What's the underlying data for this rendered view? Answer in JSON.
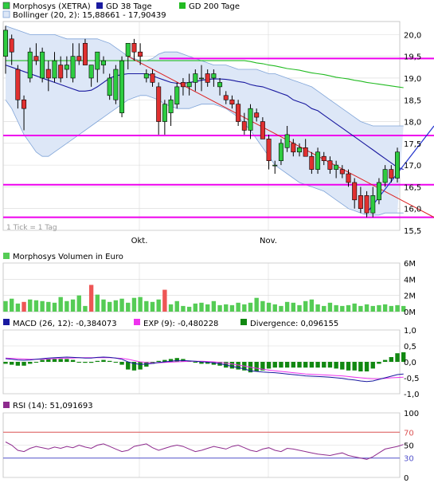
{
  "colors": {
    "up": "#2ecc40",
    "down": "#e03030",
    "gd38": "#1a1aa0",
    "gd200": "#22bb22",
    "band_fill": "#dde7f7",
    "band_line": "#7fa4d8",
    "magenta": "#ee00ee",
    "trend_red": "#dd2222",
    "trend_blue": "#2233cc",
    "volume": "#55cc55",
    "volume_high": "#ee5555",
    "macd": "#1a1aa0",
    "exp": "#ee33ee",
    "divergence": "#118811",
    "rsi": "#8e2b8e",
    "rsi_ref_70": "#dd5555",
    "rsi_ref_30": "#5555cc",
    "grid": "#d8d8d8"
  },
  "legend_main": {
    "series1": "Morphosys (XETRA)",
    "series2": "GD 38 Tage",
    "series3": "GD 200 Tage",
    "bollinger": "Bollinger (20, 2): 15,88661 - 17,90439"
  },
  "tick_note": "1 Tick = 1 Tag",
  "x_labels": [
    "Okt.",
    "Nov."
  ],
  "volume_title": "Morphosys Volumen in Euro",
  "macd_legend": {
    "macd": "MACD (26, 12): -0,384073",
    "exp": "EXP (9): -0,480228",
    "div": "Divergence: 0,096155"
  },
  "rsi_legend": "RSI (14): 51,091693",
  "chart_data": [
    {
      "type": "candlestick",
      "title": "Morphosys (XETRA)",
      "y_ticks": [
        "20,0",
        "19,5",
        "19,0",
        "18,5",
        "18,0",
        "17,5",
        "17,0",
        "16,5",
        "16,0",
        "15,5"
      ],
      "ylim": [
        15.5,
        20.3
      ],
      "x_ticks": [
        "Okt.",
        "Nov."
      ],
      "grid": true,
      "legend_position": "top-left",
      "candles": [
        {
          "o": 19.5,
          "h": 20.2,
          "l": 19.1,
          "c": 20.1
        },
        {
          "o": 19.9,
          "h": 20.0,
          "l": 19.3,
          "c": 19.6
        },
        {
          "o": 19.2,
          "h": 19.3,
          "l": 18.3,
          "c": 18.5
        },
        {
          "o": 18.5,
          "h": 18.6,
          "l": 17.8,
          "c": 18.3
        },
        {
          "o": 19.0,
          "h": 19.7,
          "l": 18.9,
          "c": 19.6
        },
        {
          "o": 19.5,
          "h": 19.8,
          "l": 19.3,
          "c": 19.4
        },
        {
          "o": 19.0,
          "h": 19.7,
          "l": 18.9,
          "c": 19.6
        },
        {
          "o": 19.2,
          "h": 19.4,
          "l": 18.7,
          "c": 19.0
        },
        {
          "o": 19.0,
          "h": 19.6,
          "l": 18.9,
          "c": 19.4
        },
        {
          "o": 19.3,
          "h": 19.5,
          "l": 18.9,
          "c": 19.0
        },
        {
          "o": 19.2,
          "h": 19.5,
          "l": 19.0,
          "c": 19.3
        },
        {
          "o": 19.0,
          "h": 19.8,
          "l": 18.9,
          "c": 19.5
        },
        {
          "o": 19.5,
          "h": 19.8,
          "l": 19.3,
          "c": 19.4
        },
        {
          "o": 19.8,
          "h": 19.9,
          "l": 19.3,
          "c": 19.3
        },
        {
          "o": 19.0,
          "h": 19.3,
          "l": 18.8,
          "c": 19.3
        },
        {
          "o": 19.2,
          "h": 19.6,
          "l": 18.9,
          "c": 19.6
        },
        {
          "o": 19.3,
          "h": 19.5,
          "l": 19.1,
          "c": 19.4
        },
        {
          "o": 18.6,
          "h": 19.1,
          "l": 18.5,
          "c": 19.0
        },
        {
          "o": 18.5,
          "h": 19.3,
          "l": 18.4,
          "c": 19.2
        },
        {
          "o": 18.2,
          "h": 19.5,
          "l": 18.1,
          "c": 19.4
        },
        {
          "o": 19.5,
          "h": 19.8,
          "l": 19.2,
          "c": 19.8
        },
        {
          "o": 19.8,
          "h": 19.9,
          "l": 19.4,
          "c": 19.6
        },
        {
          "o": 19.6,
          "h": 19.8,
          "l": 19.3,
          "c": 19.5
        },
        {
          "o": 19.0,
          "h": 19.2,
          "l": 18.9,
          "c": 19.1
        },
        {
          "o": 19.1,
          "h": 19.2,
          "l": 18.8,
          "c": 18.9
        },
        {
          "o": 18.8,
          "h": 18.9,
          "l": 17.7,
          "c": 18.0
        },
        {
          "o": 18.0,
          "h": 18.5,
          "l": 17.7,
          "c": 18.4
        },
        {
          "o": 18.2,
          "h": 18.6,
          "l": 17.9,
          "c": 18.5
        },
        {
          "o": 18.4,
          "h": 18.9,
          "l": 18.3,
          "c": 18.8
        },
        {
          "o": 18.9,
          "h": 19.0,
          "l": 18.6,
          "c": 18.8
        },
        {
          "o": 18.8,
          "h": 19.1,
          "l": 18.6,
          "c": 18.9
        },
        {
          "o": 18.9,
          "h": 19.2,
          "l": 18.7,
          "c": 19.1
        },
        {
          "o": 19.0,
          "h": 19.3,
          "l": 18.7,
          "c": 19.0
        },
        {
          "o": 19.1,
          "h": 19.2,
          "l": 18.8,
          "c": 18.9
        },
        {
          "o": 19.0,
          "h": 19.2,
          "l": 18.8,
          "c": 19.1
        },
        {
          "o": 18.8,
          "h": 19.0,
          "l": 18.6,
          "c": 18.9
        },
        {
          "o": 18.6,
          "h": 18.7,
          "l": 18.4,
          "c": 18.5
        },
        {
          "o": 18.5,
          "h": 18.6,
          "l": 18.3,
          "c": 18.4
        },
        {
          "o": 18.4,
          "h": 18.5,
          "l": 17.9,
          "c": 18.0
        },
        {
          "o": 18.0,
          "h": 18.2,
          "l": 17.7,
          "c": 17.8
        },
        {
          "o": 17.8,
          "h": 18.4,
          "l": 17.6,
          "c": 18.3
        },
        {
          "o": 18.2,
          "h": 18.3,
          "l": 18.0,
          "c": 18.1
        },
        {
          "o": 18.0,
          "h": 18.1,
          "l": 17.6,
          "c": 17.6
        },
        {
          "o": 17.6,
          "h": 17.7,
          "l": 16.9,
          "c": 17.1
        },
        {
          "o": 17.0,
          "h": 17.1,
          "l": 16.8,
          "c": 17.0
        },
        {
          "o": 17.1,
          "h": 17.6,
          "l": 17.0,
          "c": 17.5
        },
        {
          "o": 17.4,
          "h": 17.9,
          "l": 17.3,
          "c": 17.7
        },
        {
          "o": 17.5,
          "h": 17.6,
          "l": 17.2,
          "c": 17.3
        },
        {
          "o": 17.3,
          "h": 17.5,
          "l": 17.2,
          "c": 17.4
        },
        {
          "o": 17.4,
          "h": 17.6,
          "l": 17.2,
          "c": 17.2
        },
        {
          "o": 17.2,
          "h": 17.3,
          "l": 16.8,
          "c": 16.9
        },
        {
          "o": 16.9,
          "h": 17.4,
          "l": 16.8,
          "c": 17.3
        },
        {
          "o": 17.2,
          "h": 17.3,
          "l": 17.0,
          "c": 17.1
        },
        {
          "o": 17.1,
          "h": 17.2,
          "l": 16.8,
          "c": 16.9
        },
        {
          "o": 16.9,
          "h": 17.1,
          "l": 16.7,
          "c": 17.0
        },
        {
          "o": 16.9,
          "h": 17.0,
          "l": 16.7,
          "c": 16.8
        },
        {
          "o": 16.8,
          "h": 16.9,
          "l": 16.5,
          "c": 16.6
        },
        {
          "o": 16.6,
          "h": 16.7,
          "l": 16.0,
          "c": 16.2
        },
        {
          "o": 16.3,
          "h": 16.5,
          "l": 15.9,
          "c": 16.0
        },
        {
          "o": 16.3,
          "h": 16.4,
          "l": 15.8,
          "c": 15.9
        },
        {
          "o": 15.9,
          "h": 16.5,
          "l": 15.8,
          "c": 16.3
        },
        {
          "o": 16.2,
          "h": 16.7,
          "l": 16.1,
          "c": 16.6
        },
        {
          "o": 16.6,
          "h": 17.0,
          "l": 16.5,
          "c": 16.9
        },
        {
          "o": 16.9,
          "h": 17.0,
          "l": 16.6,
          "c": 16.7
        },
        {
          "o": 16.7,
          "h": 17.4,
          "l": 16.6,
          "c": 17.3
        }
      ],
      "gd38": [
        19.3,
        19.25,
        19.2,
        19.15,
        19.1,
        19.05,
        19.0,
        18.95,
        18.9,
        18.85,
        18.8,
        18.75,
        18.7,
        18.7,
        18.72,
        18.8,
        18.9,
        19.0,
        19.05,
        19.08,
        19.1,
        19.1,
        19.1,
        19.1,
        19.05,
        19.0,
        18.95,
        18.9,
        18.88,
        18.88,
        18.9,
        18.92,
        18.95,
        18.97,
        18.98,
        18.98,
        18.97,
        18.95,
        18.92,
        18.9,
        18.85,
        18.82,
        18.8,
        18.75,
        18.7,
        18.65,
        18.6,
        18.5,
        18.45,
        18.4,
        18.3,
        18.25,
        18.15,
        18.05,
        17.95,
        17.85,
        17.75,
        17.65,
        17.55,
        17.45,
        17.35,
        17.25,
        17.15,
        17.05,
        16.95,
        16.9
      ],
      "gd200": [
        19.4,
        19.4,
        19.4,
        19.4,
        19.4,
        19.4,
        19.4,
        19.4,
        19.4,
        19.4,
        19.4,
        19.4,
        19.4,
        19.4,
        19.4,
        19.4,
        19.4,
        19.4,
        19.4,
        19.4,
        19.4,
        19.4,
        19.4,
        19.4,
        19.4,
        19.4,
        19.4,
        19.4,
        19.4,
        19.4,
        19.4,
        19.4,
        19.4,
        19.4,
        19.4,
        19.4,
        19.4,
        19.4,
        19.4,
        19.4,
        19.38,
        19.35,
        19.33,
        19.3,
        19.28,
        19.25,
        19.22,
        19.2,
        19.18,
        19.15,
        19.12,
        19.1,
        19.08,
        19.05,
        19.02,
        19.0,
        18.98,
        18.95,
        18.93,
        18.9,
        18.88,
        18.86,
        18.84,
        18.82,
        18.8,
        18.78
      ],
      "bollinger_upper": [
        20.2,
        20.15,
        20.1,
        20.05,
        20.0,
        20.0,
        20.0,
        20.0,
        20.0,
        19.95,
        19.9,
        19.9,
        19.9,
        19.9,
        19.9,
        19.9,
        19.85,
        19.8,
        19.7,
        19.6,
        19.5,
        19.45,
        19.4,
        19.4,
        19.45,
        19.55,
        19.6,
        19.6,
        19.6,
        19.55,
        19.5,
        19.45,
        19.4,
        19.35,
        19.3,
        19.3,
        19.3,
        19.25,
        19.2,
        19.2,
        19.2,
        19.2,
        19.15,
        19.1,
        19.1,
        19.05,
        19.0,
        18.95,
        18.9,
        18.85,
        18.8,
        18.7,
        18.6,
        18.5,
        18.4,
        18.3,
        18.2,
        18.1,
        18.0,
        17.95,
        17.9,
        17.9,
        17.9,
        17.9,
        17.9,
        17.9
      ],
      "bollinger_lower": [
        18.5,
        18.3,
        18.0,
        17.7,
        17.5,
        17.3,
        17.2,
        17.2,
        17.3,
        17.4,
        17.5,
        17.6,
        17.7,
        17.8,
        17.9,
        18.0,
        18.1,
        18.2,
        18.3,
        18.4,
        18.5,
        18.55,
        18.6,
        18.6,
        18.55,
        18.5,
        18.4,
        18.35,
        18.3,
        18.3,
        18.3,
        18.35,
        18.4,
        18.4,
        18.4,
        18.35,
        18.3,
        18.2,
        18.1,
        17.95,
        17.8,
        17.6,
        17.4,
        17.2,
        17.0,
        16.9,
        16.8,
        16.7,
        16.6,
        16.55,
        16.5,
        16.45,
        16.4,
        16.3,
        16.2,
        16.1,
        16.0,
        15.95,
        15.9,
        15.85,
        15.85,
        15.85,
        15.9,
        15.9,
        15.9,
        15.9
      ],
      "horizontal_lines": [
        19.45,
        17.68,
        16.55,
        15.8
      ],
      "trendline_down": {
        "from": [
          20,
          19.5
        ],
        "to": [
          66,
          15.8
        ]
      },
      "trendline_up": {
        "from": [
          59,
          15.9
        ],
        "to": [
          66,
          17.9
        ]
      }
    },
    {
      "type": "bar",
      "title": "Morphosys Volumen in Euro",
      "y_ticks": [
        "6M",
        "4M",
        "2M",
        "0M"
      ],
      "ylim": [
        0,
        6
      ],
      "values": [
        1.3,
        1.6,
        1.0,
        1.2,
        1.5,
        1.4,
        1.3,
        1.2,
        1.1,
        1.8,
        1.3,
        1.5,
        2.0,
        0.7,
        3.3,
        2.1,
        1.5,
        1.2,
        1.4,
        1.6,
        1.1,
        1.7,
        1.8,
        1.3,
        1.2,
        1.5,
        2.7,
        0.9,
        1.3,
        0.7,
        0.6,
        1.0,
        1.1,
        0.9,
        1.3,
        0.8,
        0.9,
        0.8,
        1.1,
        0.9,
        1.1,
        1.7,
        1.3,
        1.1,
        0.9,
        0.7,
        1.2,
        1.1,
        0.8,
        1.3,
        1.5,
        0.9,
        0.7,
        1.1,
        0.8,
        0.7,
        0.8,
        1.0,
        0.7,
        0.9,
        0.7,
        0.8,
        0.9,
        0.7,
        0.8,
        0.7
      ],
      "high_days": [
        3,
        14,
        26
      ]
    },
    {
      "type": "line",
      "title": "MACD (26, 12)",
      "y_ticks": [
        "1,0",
        "0,5",
        "0,0",
        "-0,5",
        "-1,0"
      ],
      "ylim": [
        -1.0,
        1.0
      ],
      "series": [
        {
          "name": "MACD (26, 12)",
          "values": [
            0.1,
            0.08,
            0.06,
            0.05,
            0.06,
            0.08,
            0.1,
            0.12,
            0.13,
            0.14,
            0.15,
            0.14,
            0.13,
            0.12,
            0.12,
            0.14,
            0.15,
            0.14,
            0.12,
            0.08,
            0.0,
            -0.05,
            -0.08,
            -0.07,
            -0.05,
            -0.02,
            0.0,
            0.02,
            0.04,
            0.04,
            0.03,
            0.02,
            0.0,
            -0.01,
            -0.03,
            -0.06,
            -0.1,
            -0.14,
            -0.18,
            -0.22,
            -0.28,
            -0.3,
            -0.32,
            -0.33,
            -0.34,
            -0.36,
            -0.38,
            -0.4,
            -0.42,
            -0.44,
            -0.45,
            -0.46,
            -0.47,
            -0.48,
            -0.5,
            -0.52,
            -0.55,
            -0.57,
            -0.6,
            -0.62,
            -0.6,
            -0.55,
            -0.5,
            -0.45,
            -0.4,
            -0.38
          ]
        },
        {
          "name": "EXP (9)",
          "values": [
            0.12,
            0.11,
            0.1,
            0.09,
            0.08,
            0.08,
            0.08,
            0.09,
            0.1,
            0.11,
            0.12,
            0.12,
            0.13,
            0.13,
            0.13,
            0.13,
            0.13,
            0.13,
            0.12,
            0.11,
            0.08,
            0.04,
            0.0,
            -0.02,
            -0.03,
            -0.03,
            -0.02,
            -0.01,
            0.0,
            0.01,
            0.02,
            0.02,
            0.02,
            0.01,
            0.0,
            -0.02,
            -0.04,
            -0.07,
            -0.1,
            -0.13,
            -0.17,
            -0.2,
            -0.23,
            -0.26,
            -0.28,
            -0.3,
            -0.32,
            -0.34,
            -0.36,
            -0.38,
            -0.39,
            -0.4,
            -0.41,
            -0.42,
            -0.43,
            -0.44,
            -0.46,
            -0.48,
            -0.5,
            -0.52,
            -0.53,
            -0.53,
            -0.52,
            -0.5,
            -0.49,
            -0.48
          ]
        }
      ],
      "divergence": [
        -0.02,
        -0.03,
        -0.04,
        -0.04,
        -0.02,
        0.0,
        0.02,
        0.03,
        0.03,
        0.03,
        0.03,
        0.02,
        0.0,
        -0.01,
        -0.01,
        0.01,
        0.02,
        0.01,
        0.0,
        -0.03,
        -0.08,
        -0.09,
        -0.08,
        -0.05,
        -0.02,
        0.01,
        0.02,
        0.03,
        0.04,
        0.03,
        0.01,
        0.0,
        -0.02,
        -0.02,
        -0.03,
        -0.04,
        -0.06,
        -0.07,
        -0.08,
        -0.09,
        -0.11,
        -0.1,
        -0.09,
        -0.07,
        -0.06,
        -0.06,
        -0.06,
        -0.06,
        -0.06,
        -0.06,
        -0.06,
        -0.06,
        -0.06,
        -0.06,
        -0.07,
        -0.08,
        -0.09,
        -0.09,
        -0.1,
        -0.1,
        -0.07,
        -0.02,
        0.02,
        0.05,
        0.09,
        0.1
      ]
    },
    {
      "type": "line",
      "title": "RSI (14)",
      "y_ticks": [
        "100",
        "70",
        "50",
        "30",
        "0"
      ],
      "ylim": [
        0,
        100
      ],
      "reference_lines": [
        70,
        30
      ],
      "values": [
        55,
        50,
        42,
        40,
        45,
        48,
        46,
        44,
        47,
        45,
        48,
        46,
        50,
        47,
        45,
        50,
        52,
        48,
        44,
        40,
        42,
        48,
        50,
        52,
        46,
        42,
        45,
        48,
        50,
        48,
        44,
        40,
        42,
        45,
        48,
        46,
        44,
        48,
        50,
        46,
        42,
        40,
        44,
        46,
        42,
        40,
        45,
        44,
        42,
        40,
        38,
        36,
        35,
        34,
        36,
        38,
        34,
        32,
        30,
        28,
        32,
        38,
        44,
        46,
        48,
        51
      ]
    }
  ]
}
